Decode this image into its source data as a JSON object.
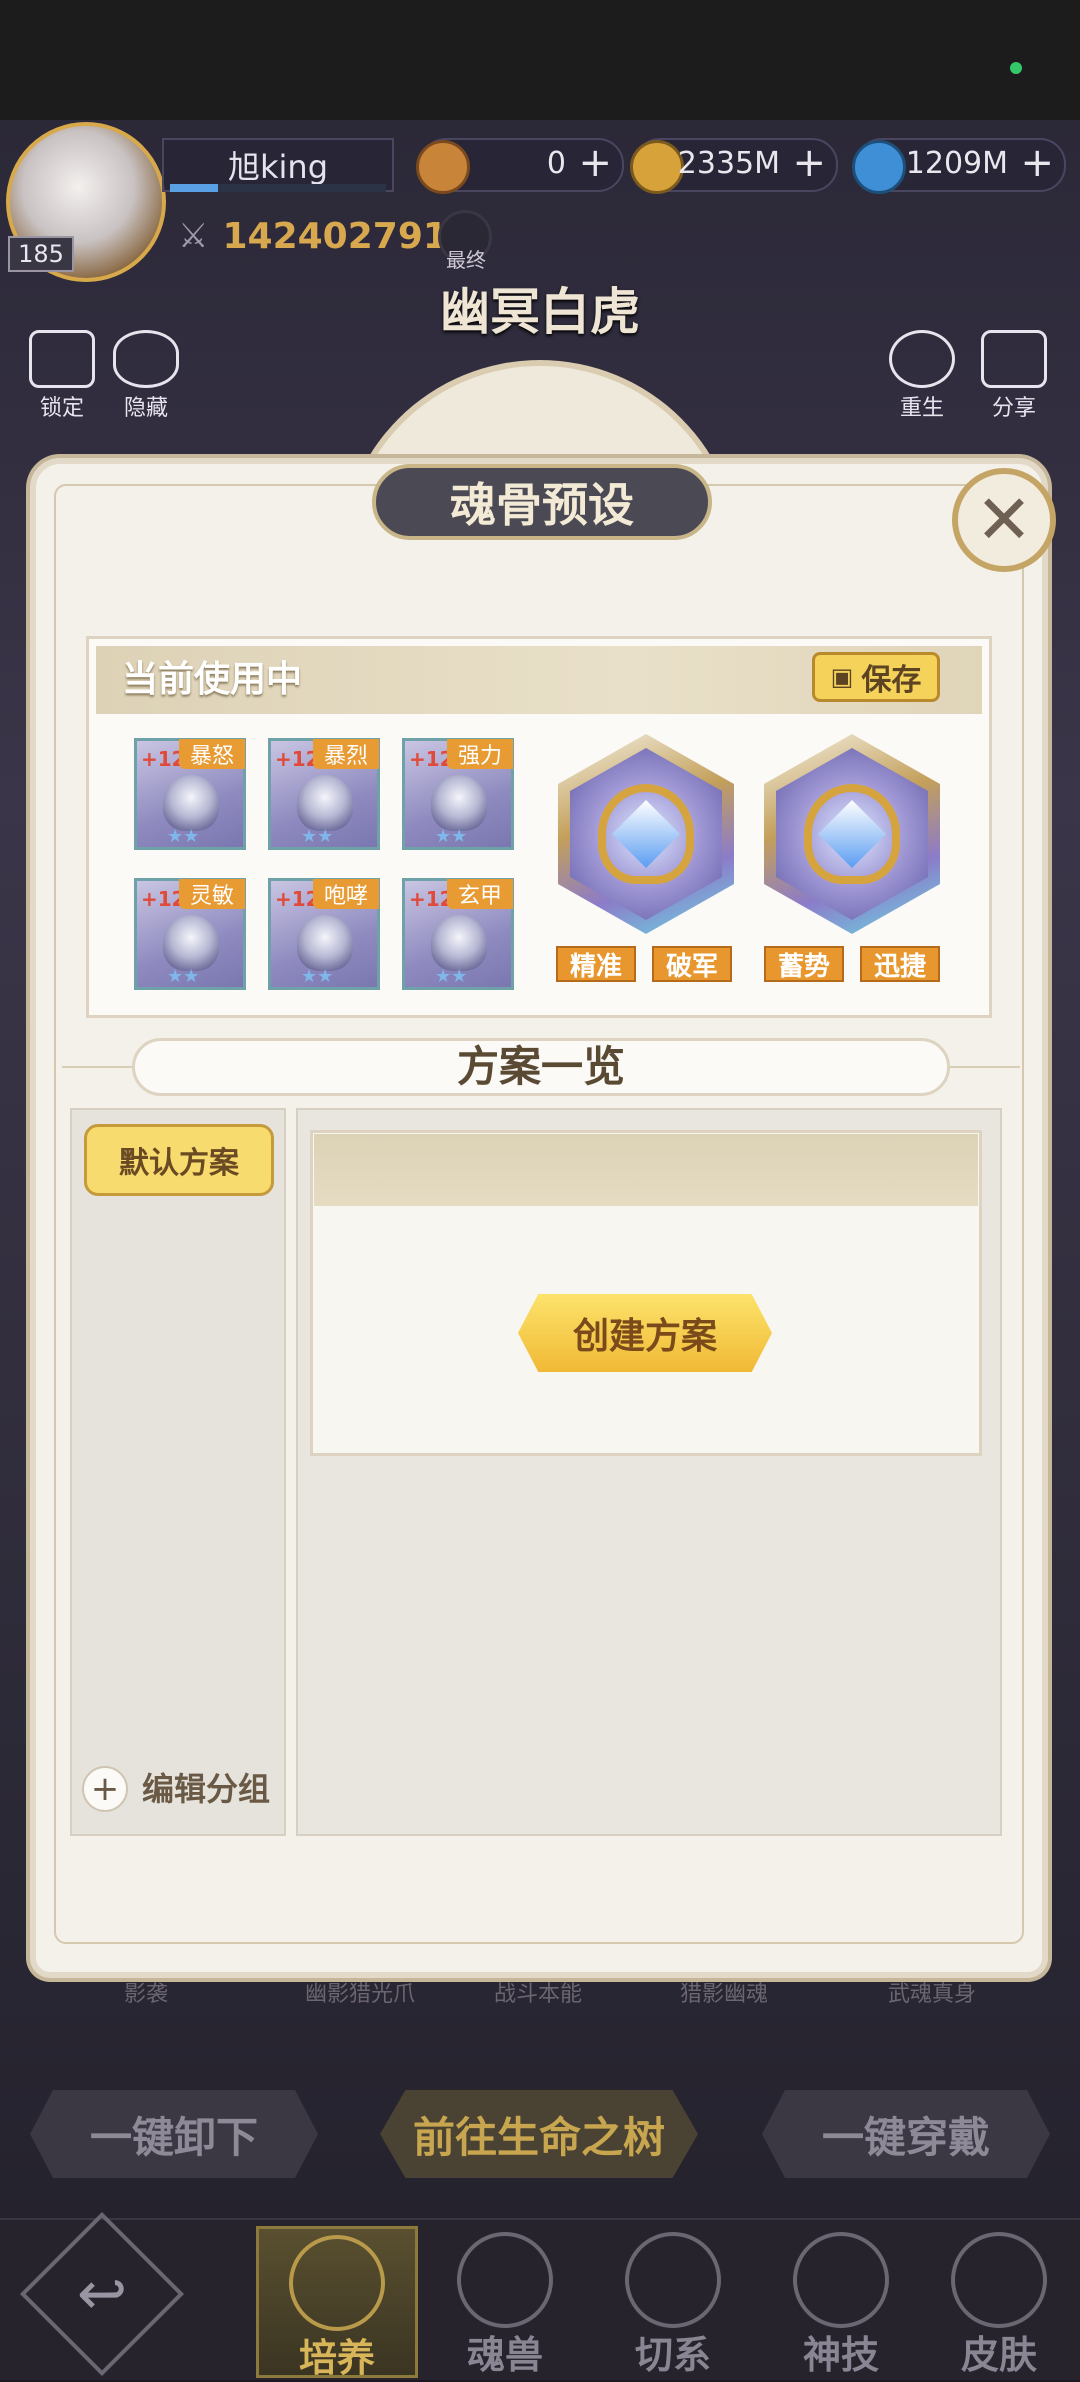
{
  "header": {
    "player_name": "旭king",
    "level": "185",
    "currencies": [
      {
        "icon": "token-coin-icon",
        "value": "0",
        "color": "#c8853a"
      },
      {
        "icon": "gold-coin-icon",
        "value": "2335M",
        "color": "#d8a23a"
      },
      {
        "icon": "potion-icon",
        "value": "1209M",
        "color": "#3f8fd6"
      }
    ],
    "power": "142402791",
    "search_label": "最终",
    "hero_name": "幽冥白虎",
    "tools_left": [
      {
        "icon": "lock-icon",
        "label": "锁定"
      },
      {
        "icon": "eye-icon",
        "label": "隐藏"
      }
    ],
    "tools_right": [
      {
        "icon": "refresh-icon",
        "label": "重生"
      },
      {
        "icon": "share-icon",
        "label": "分享"
      }
    ],
    "exp_progress": 0.22
  },
  "modal": {
    "title": "魂骨预设",
    "current": {
      "title": "当前使用中",
      "save_label": "保存",
      "bones": [
        {
          "level": "+12",
          "tag": "暴怒",
          "stars": "★★"
        },
        {
          "level": "+12",
          "tag": "暴烈",
          "stars": "★★"
        },
        {
          "level": "+12",
          "tag": "强力",
          "stars": "★★"
        },
        {
          "level": "+12",
          "tag": "灵敏",
          "stars": "★★"
        },
        {
          "level": "+12",
          "tag": "咆哮",
          "stars": "★★"
        },
        {
          "level": "+12",
          "tag": "玄甲",
          "stars": "★★"
        }
      ],
      "skill_sets": [
        {
          "tags": [
            "精准",
            "破军"
          ]
        },
        {
          "tags": [
            "蓄势",
            "迅捷"
          ]
        }
      ]
    },
    "list_title": "方案一览",
    "default_scheme": "默认方案",
    "create_scheme": "创建方案",
    "edit_group": "编辑分组"
  },
  "below_modal": [
    "影袭",
    "幽影猎光爪",
    "战斗本能",
    "猎影幽魂",
    "武魂真身"
  ],
  "actions": {
    "unequip_all": "一键卸下",
    "go_tree": "前往生命之树",
    "equip_all": "一键穿戴"
  },
  "nav": {
    "back_icon": "back-arrow-icon",
    "items": [
      {
        "label": "培养",
        "icon": "cultivate-icon",
        "active": true
      },
      {
        "label": "魂兽",
        "icon": "paw-icon",
        "active": false
      },
      {
        "label": "切系",
        "icon": "sun-icon",
        "active": false
      },
      {
        "label": "神技",
        "icon": "emblem-icon",
        "active": false
      },
      {
        "label": "皮肤",
        "icon": "fox-icon",
        "active": false
      }
    ]
  }
}
